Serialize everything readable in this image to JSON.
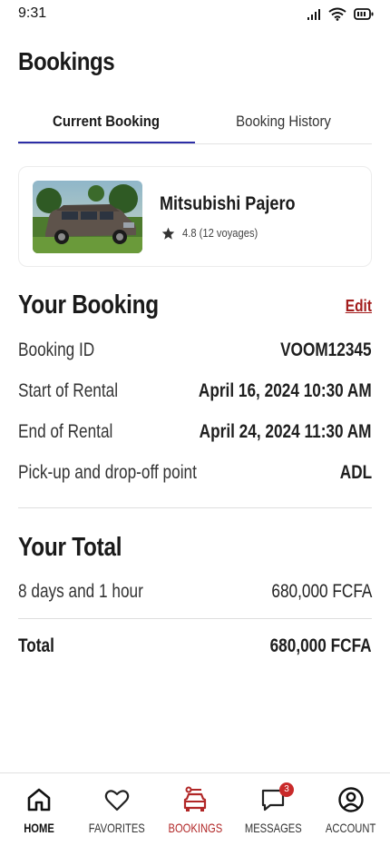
{
  "status_bar": {
    "time": "9:31",
    "icons": [
      "signal-icon",
      "wifi-icon",
      "battery-icon"
    ]
  },
  "page": {
    "title": "Bookings"
  },
  "tabs": [
    {
      "label": "Current Booking",
      "active": true
    },
    {
      "label": "Booking History",
      "active": false
    }
  ],
  "car": {
    "name": "Mitsubishi Pajero",
    "rating": "4.8",
    "rating_text": "4.8 (12 voyages)"
  },
  "booking": {
    "title": "Your Booking",
    "edit_label": "Edit",
    "rows": [
      {
        "label": "Booking ID",
        "value": "VOOM12345"
      },
      {
        "label": "Start of Rental",
        "value": "April 16, 2024 10:30 AM"
      },
      {
        "label": "End of Rental",
        "value": "April 24, 2024 11:30 AM"
      },
      {
        "label": "Pick-up and drop-off point",
        "value": "ADL"
      }
    ]
  },
  "total": {
    "title": "Your Total",
    "duration_label": "8 days and 1 hour",
    "duration_value": "680,000 FCFA",
    "total_label": "Total",
    "total_value": "680,000 FCFA"
  },
  "nav": {
    "items": [
      {
        "label": "HOME",
        "icon": "home-icon"
      },
      {
        "label": "FAVORITES",
        "icon": "heart-icon"
      },
      {
        "label": "BOOKINGS",
        "icon": "car-icon"
      },
      {
        "label": "MESSAGES",
        "icon": "chat-icon",
        "badge": "3"
      },
      {
        "label": "ACCOUNT",
        "icon": "user-circle-icon"
      }
    ]
  },
  "colors": {
    "accent": "#2c2ea6",
    "brand_red": "#a31d1d",
    "badge": "#c92a2a"
  }
}
